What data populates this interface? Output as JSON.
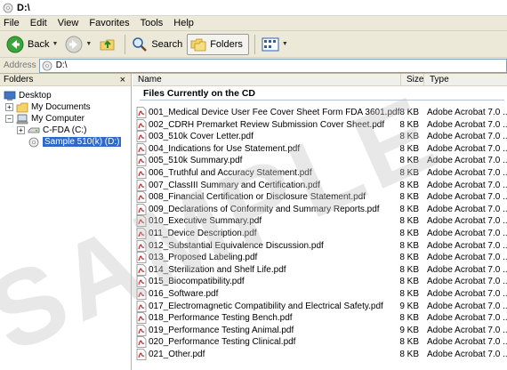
{
  "window": {
    "title": "D:\\"
  },
  "menu": [
    "File",
    "Edit",
    "View",
    "Favorites",
    "Tools",
    "Help"
  ],
  "toolbar": {
    "back_label": "Back",
    "search_label": "Search",
    "folders_label": "Folders"
  },
  "address": {
    "label": "Address",
    "value": "D:\\"
  },
  "folders_pane": {
    "title": "Folders",
    "close": "×",
    "items": [
      {
        "label": "Desktop",
        "icon": "desktop-icon"
      },
      {
        "label": "My Documents",
        "icon": "folder-icon"
      },
      {
        "label": "My Computer",
        "icon": "computer-icon"
      },
      {
        "label": "C-FDA (C:)",
        "icon": "drive-icon"
      },
      {
        "label": "Sample 510(k) (D:)",
        "icon": "cd-drive-icon"
      }
    ]
  },
  "columns": {
    "name": "Name",
    "size": "Size",
    "type": "Type"
  },
  "group_title": "Files Currently on the CD",
  "files": [
    {
      "name": "001_Medical Device User Fee Cover Sheet Form FDA 3601.pdf",
      "size": "8 KB",
      "type": "Adobe Acrobat 7.0 ..."
    },
    {
      "name": "002_CDRH Premarket Review Submission Cover Sheet.pdf",
      "size": "8 KB",
      "type": "Adobe Acrobat 7.0 ..."
    },
    {
      "name": "003_510k Cover Letter.pdf",
      "size": "8 KB",
      "type": "Adobe Acrobat 7.0 ..."
    },
    {
      "name": "004_Indications for Use Statement.pdf",
      "size": "8 KB",
      "type": "Adobe Acrobat 7.0 ..."
    },
    {
      "name": "005_510k Summary.pdf",
      "size": "8 KB",
      "type": "Adobe Acrobat 7.0 ..."
    },
    {
      "name": "006_Truthful and Accuracy Statement.pdf",
      "size": "8 KB",
      "type": "Adobe Acrobat 7.0 ..."
    },
    {
      "name": "007_ClassIII Summary and Certification.pdf",
      "size": "8 KB",
      "type": "Adobe Acrobat 7.0 ..."
    },
    {
      "name": "008_Financial Certification or Disclosure Statement.pdf",
      "size": "8 KB",
      "type": "Adobe Acrobat 7.0 ..."
    },
    {
      "name": "009_Declarations of Conformity and Summary Reports.pdf",
      "size": "8 KB",
      "type": "Adobe Acrobat 7.0 ..."
    },
    {
      "name": "010_Executive Summary.pdf",
      "size": "8 KB",
      "type": "Adobe Acrobat 7.0 ..."
    },
    {
      "name": "011_Device Description.pdf",
      "size": "8 KB",
      "type": "Adobe Acrobat 7.0 ..."
    },
    {
      "name": "012_Substantial Equivalence Discussion.pdf",
      "size": "8 KB",
      "type": "Adobe Acrobat 7.0 ..."
    },
    {
      "name": "013_Proposed Labeling.pdf",
      "size": "8 KB",
      "type": "Adobe Acrobat 7.0 ..."
    },
    {
      "name": "014_Sterilization and Shelf Life.pdf",
      "size": "8 KB",
      "type": "Adobe Acrobat 7.0 ..."
    },
    {
      "name": "015_Biocompatibility.pdf",
      "size": "8 KB",
      "type": "Adobe Acrobat 7.0 ..."
    },
    {
      "name": "016_Software.pdf",
      "size": "8 KB",
      "type": "Adobe Acrobat 7.0 ..."
    },
    {
      "name": "017_Electromagnetic Compatibility and Electrical Safety.pdf",
      "size": "9 KB",
      "type": "Adobe Acrobat 7.0 ..."
    },
    {
      "name": "018_Performance Testing Bench.pdf",
      "size": "8 KB",
      "type": "Adobe Acrobat 7.0 ..."
    },
    {
      "name": "019_Performance Testing Animal.pdf",
      "size": "9 KB",
      "type": "Adobe Acrobat 7.0 ..."
    },
    {
      "name": "020_Performance Testing Clinical.pdf",
      "size": "8 KB",
      "type": "Adobe Acrobat 7.0 ..."
    },
    {
      "name": "021_Other.pdf",
      "size": "8 KB",
      "type": "Adobe Acrobat 7.0 ..."
    }
  ],
  "watermark": "SAMPLE",
  "colors": {
    "selection": "#316ac5",
    "chrome": "#ece9d8",
    "pdf_red": "#cc1f1f"
  }
}
